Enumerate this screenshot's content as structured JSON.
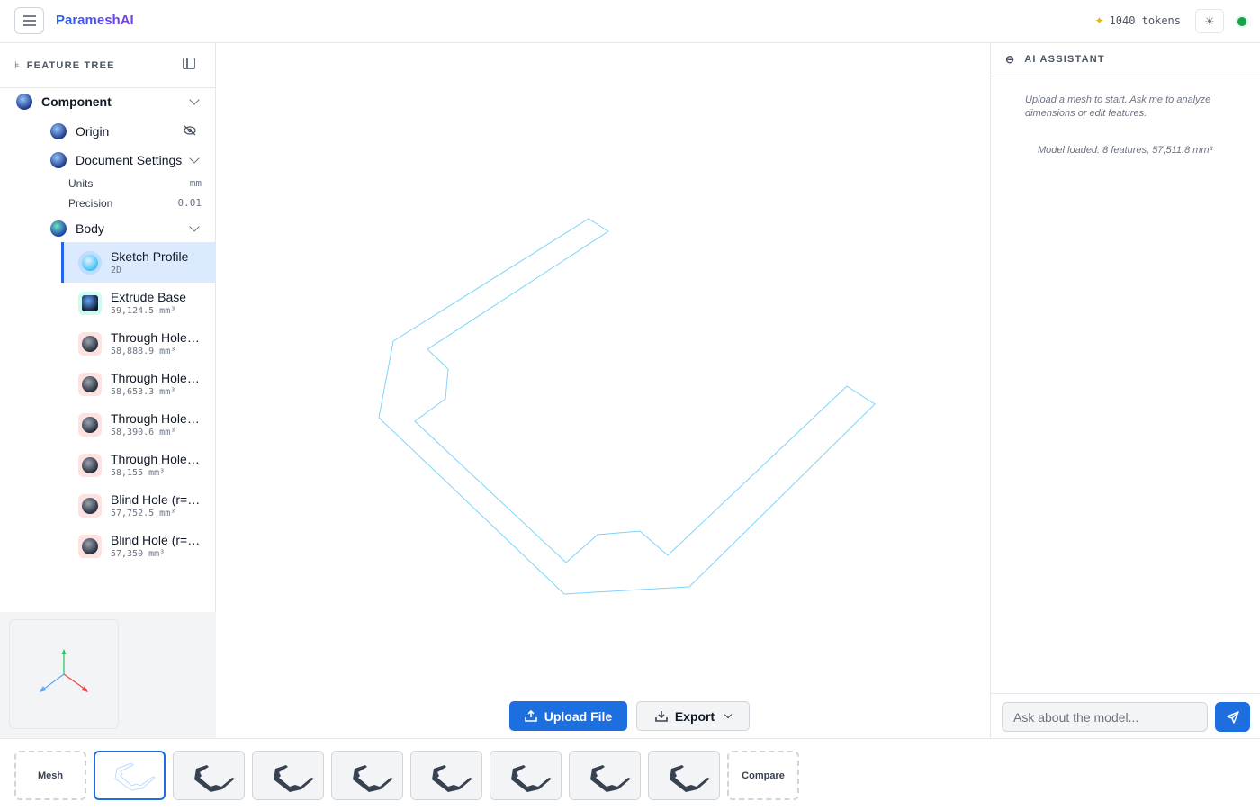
{
  "header": {
    "brand": "ParameshAI",
    "tokens": "1040 tokens"
  },
  "feature_tree": {
    "title": "FEATURE TREE",
    "component": "Component",
    "origin": "Origin",
    "document_settings": "Document Settings",
    "units_label": "Units",
    "units_value": "mm",
    "precision_label": "Precision",
    "precision_value": "0.01",
    "body": "Body",
    "features": [
      {
        "name": "Sketch Profile",
        "sub": "2D",
        "kind": "sketch"
      },
      {
        "name": "Extrude Base",
        "sub": "59,124.5 mm³",
        "kind": "extrude"
      },
      {
        "name": "Through Hole (…",
        "sub": "58,888.9 mm³",
        "kind": "hole"
      },
      {
        "name": "Through Hole (…",
        "sub": "58,653.3 mm³",
        "kind": "hole"
      },
      {
        "name": "Through Hole (…",
        "sub": "58,390.6 mm³",
        "kind": "hole"
      },
      {
        "name": "Through Hole (…",
        "sub": "58,155 mm³",
        "kind": "hole"
      },
      {
        "name": "Blind Hole (r=2…",
        "sub": "57,752.5 mm³",
        "kind": "hole"
      },
      {
        "name": "Blind Hole (r=2…",
        "sub": "57,350 mm³",
        "kind": "hole"
      }
    ]
  },
  "viewport": {
    "upload_label": "Upload File",
    "export_label": "Export",
    "sketch_color": "#7dd3fc"
  },
  "assistant": {
    "title": "AI ASSISTANT",
    "hint": "Upload a mesh to start. Ask me to analyze dimensions or edit features.",
    "status": "Model loaded: 8 features, 57,511.8 mm³",
    "input_placeholder": "Ask about the model..."
  },
  "strip": {
    "mesh_label": "Mesh",
    "compare_label": "Compare"
  },
  "colors": {
    "accent": "#1d6fe0",
    "selected_bg": "#dbeafe",
    "status_ok": "#16a34a"
  }
}
